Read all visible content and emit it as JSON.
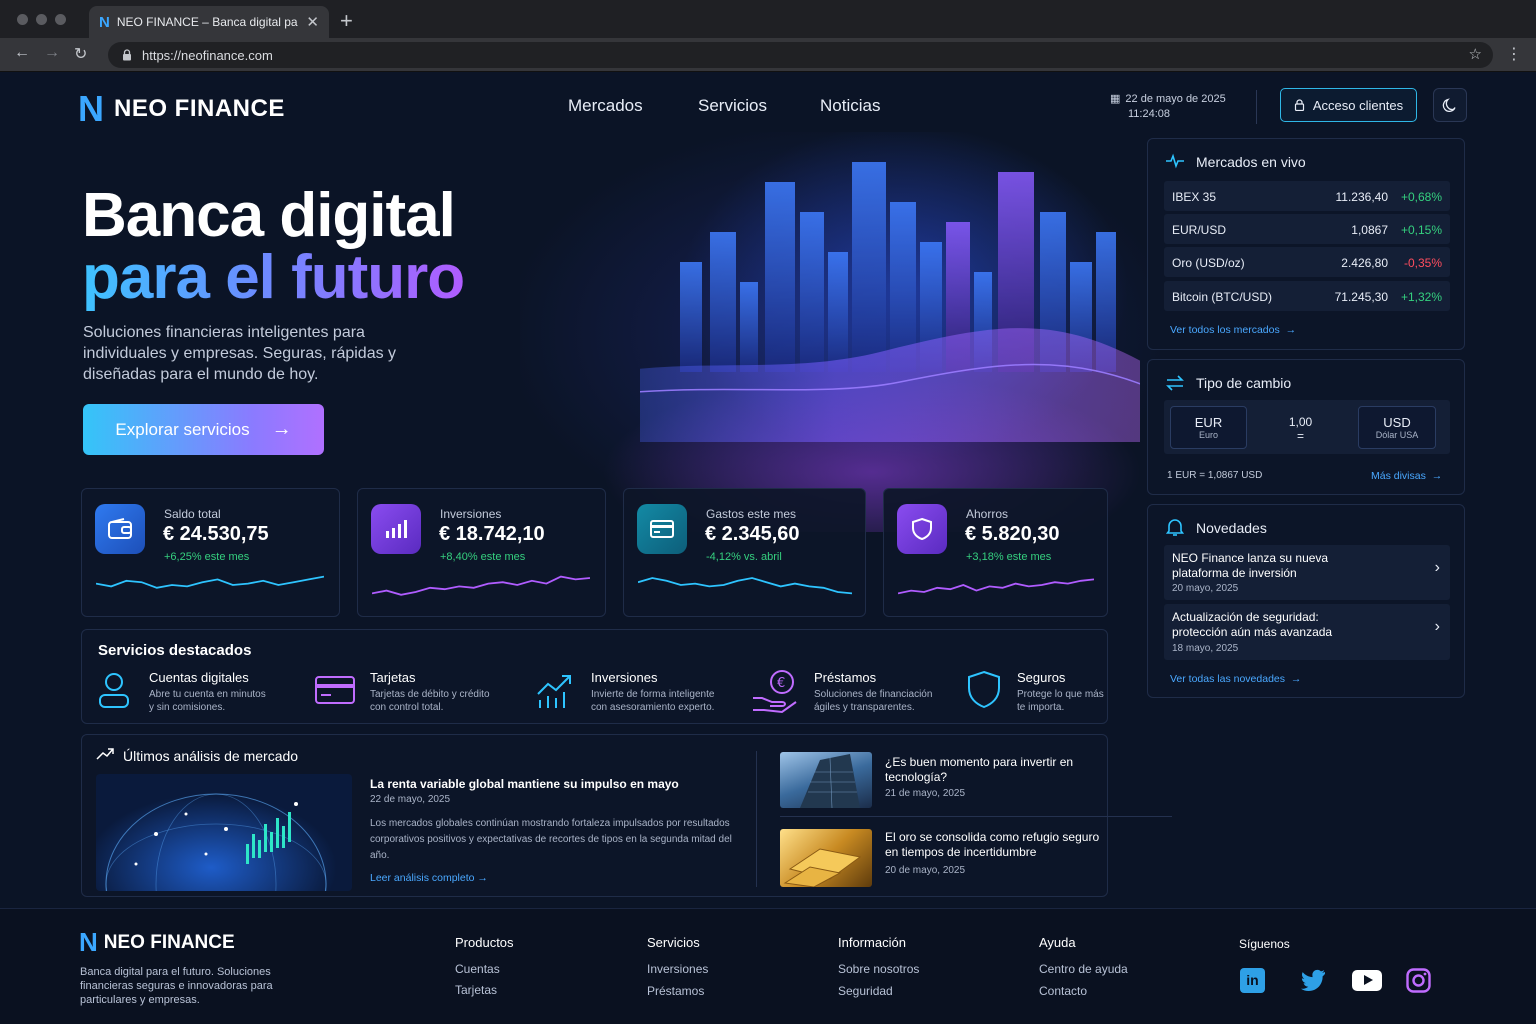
{
  "browser": {
    "tab_title": "NEO FINANCE – Banca digital para",
    "url": "https://neofinance.com"
  },
  "header": {
    "brand": "NEO FINANCE",
    "nav": [
      "Mercados",
      "Servicios",
      "Noticias"
    ],
    "date": "22 de mayo de 2025",
    "time": "11:24:08",
    "access_label": "Acceso clientes"
  },
  "hero": {
    "title_line1": "Banca digital",
    "title_line2": "para el futuro",
    "subtitle": "Soluciones financieras inteligentes para individuales y empresas. Seguras, rápidas y diseñadas para el mundo de hoy.",
    "cta": "Explorar servicios"
  },
  "stats": [
    {
      "label": "Saldo total",
      "value": "€ 24.530,75",
      "delta": "+6,25% este mes",
      "delta_color": "#35d07f",
      "icon": "wallet-icon",
      "color": "#2e6fe0",
      "spark": [
        0.45,
        0.55,
        0.35,
        0.4,
        0.6,
        0.5,
        0.55,
        0.4,
        0.3,
        0.5,
        0.45,
        0.35,
        0.5,
        0.4,
        0.3,
        0.2
      ]
    },
    {
      "label": "Inversiones",
      "value": "€ 18.742,10",
      "delta": "+8,40% este mes",
      "delta_color": "#35d07f",
      "icon": "bar-chart-icon",
      "color": "#7b3fe4",
      "spark": [
        0.8,
        0.7,
        0.85,
        0.75,
        0.6,
        0.65,
        0.55,
        0.6,
        0.45,
        0.4,
        0.5,
        0.35,
        0.45,
        0.2,
        0.3,
        0.25
      ]
    },
    {
      "label": "Gastos este mes",
      "value": "€ 2.345,60",
      "delta": "-4,12% vs. abril",
      "delta_color": "#35d07f",
      "icon": "card-icon",
      "color": "#0f7f99",
      "spark": [
        0.4,
        0.25,
        0.35,
        0.5,
        0.45,
        0.55,
        0.5,
        0.35,
        0.25,
        0.4,
        0.55,
        0.45,
        0.55,
        0.6,
        0.75,
        0.8
      ]
    },
    {
      "label": "Ahorros",
      "value": "€ 5.820,30",
      "delta": "+3,18% este mes",
      "delta_color": "#35d07f",
      "icon": "shield-icon",
      "color": "#7b3fe4",
      "spark": [
        0.8,
        0.7,
        0.75,
        0.6,
        0.65,
        0.5,
        0.7,
        0.55,
        0.6,
        0.45,
        0.55,
        0.5,
        0.4,
        0.45,
        0.35,
        0.3
      ]
    }
  ],
  "services": {
    "title": "Servicios destacados",
    "items": [
      {
        "name": "Cuentas digitales",
        "desc1": "Abre tu cuenta en minutos",
        "desc2": "y sin comisiones.",
        "icon": "user-icon"
      },
      {
        "name": "Tarjetas",
        "desc1": "Tarjetas de débito y crédito",
        "desc2": "con control total.",
        "icon": "credit-card-icon"
      },
      {
        "name": "Inversiones",
        "desc1": "Invierte de forma inteligente",
        "desc2": "con asesoramiento experto.",
        "icon": "growth-chart-icon"
      },
      {
        "name": "Préstamos",
        "desc1": "Soluciones de financiación",
        "desc2": "ágiles y transparentes.",
        "icon": "euro-hand-icon"
      },
      {
        "name": "Seguros",
        "desc1": "Protege lo que más",
        "desc2": "te importa.",
        "icon": "shield-outline-icon"
      }
    ]
  },
  "analysis": {
    "title": "Últimos análisis de mercado",
    "main": {
      "headline": "La renta variable global mantiene su impulso en mayo",
      "date": "22 de mayo, 2025",
      "body": "Los mercados globales continúan mostrando fortaleza impulsados por resultados corporativos positivos y expectativas de recortes de tipos en la segunda mitad del año.",
      "link": "Leer análisis completo"
    },
    "side": [
      {
        "headline": "¿Es buen momento para invertir en tecnología?",
        "date": "21 de mayo, 2025"
      },
      {
        "headline": "El oro se consolida como refugio seguro en tiempos de incertidumbre",
        "date": "20 de mayo, 2025"
      }
    ]
  },
  "markets": {
    "title": "Mercados en vivo",
    "rows": [
      {
        "name": "IBEX 35",
        "value": "11.236,40",
        "change": "+0,68%",
        "color": "#35d07f"
      },
      {
        "name": "EUR/USD",
        "value": "1,0867",
        "change": "+0,15%",
        "color": "#35d07f"
      },
      {
        "name": "Oro (USD/oz)",
        "value": "2.426,80",
        "change": "-0,35%",
        "color": "#ff4d5e"
      },
      {
        "name": "Bitcoin (BTC/USD)",
        "value": "71.245,30",
        "change": "+1,32%",
        "color": "#35d07f"
      }
    ],
    "link": "Ver todos los mercados"
  },
  "exchange": {
    "title": "Tipo de cambio",
    "from_code": "EUR",
    "from_name": "Euro",
    "amount": "1,00",
    "equals": "=",
    "to_code": "USD",
    "to_name": "Dólar USA",
    "rate": "1 EUR = 1,0867 USD",
    "link": "Más divisas"
  },
  "news": {
    "title": "Novedades",
    "items": [
      {
        "line1": "NEO Finance lanza su nueva",
        "line2": "plataforma de inversión",
        "date": "20 mayo, 2025"
      },
      {
        "line1": "Actualización de seguridad:",
        "line2": "protección aún más avanzada",
        "date": "18 mayo, 2025"
      }
    ],
    "link": "Ver todas las novedades"
  },
  "footer": {
    "brand": "NEO FINANCE",
    "tagline": "Banca digital para el futuro. Soluciones financieras seguras e innovadoras para particulares y empresas.",
    "columns": [
      {
        "title": "Productos",
        "items": [
          "Cuentas",
          "Tarjetas"
        ]
      },
      {
        "title": "Servicios",
        "items": [
          "Inversiones",
          "Préstamos"
        ]
      },
      {
        "title": "Información",
        "items": [
          "Sobre nosotros",
          "Seguridad"
        ]
      },
      {
        "title": "Ayuda",
        "items": [
          "Centro de ayuda",
          "Contacto"
        ]
      }
    ],
    "social_title": "Síguenos"
  },
  "colors": {
    "accent": "#3ba7ff",
    "purple": "#b05cff",
    "positive": "#35d07f",
    "negative": "#ff4d5e"
  }
}
